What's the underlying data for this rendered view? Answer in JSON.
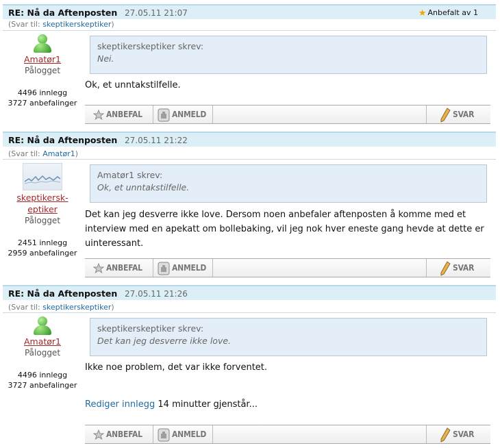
{
  "posts": [
    {
      "title": "RE: Nå da Aftenposten",
      "date": "27.05.11 21:07",
      "recommended": "Anbefalt av 1",
      "reply_prefix": "(Svar til:",
      "reply_to": "skeptikerskeptiker",
      "reply_suffix": ")",
      "author_line1": "Amatør1",
      "author_line2": "",
      "status": "Pålogget",
      "posts_count": "4496 innlegg",
      "recommendations": "3727 anbefalinger",
      "quote_author": "skeptikerskeptiker skrev:",
      "quote_text": "Nei.",
      "body": "Ok, et unntakstilfelle.",
      "avatar": "person-icon"
    },
    {
      "title": "RE: Nå da Aftenposten",
      "date": "27.05.11 21:22",
      "reply_prefix": "(Svar til:",
      "reply_to": "Amatør1",
      "reply_suffix": ")",
      "author_line1": "skeptikersk-",
      "author_line2": "eptiker",
      "status": "Pålogget",
      "posts_count": "2451 innlegg",
      "recommendations": "2959 anbefalinger",
      "quote_author": "Amatør1 skrev:",
      "quote_text": "Ok, et unntakstilfelle.",
      "body": "Det kan jeg desverre ikke love. Dersom noen anbefaler aftenposten å komme med et interview med en apekatt om bollebaking, vil jeg nok hver eneste gang hevde at dette er uinteressant.",
      "avatar": "chart-thumbnail"
    },
    {
      "title": "RE: Nå da Aftenposten",
      "date": "27.05.11 21:26",
      "reply_prefix": "(Svar til:",
      "reply_to": "skeptikerskeptiker",
      "reply_suffix": ")",
      "author_line1": "Amatør1",
      "author_line2": "",
      "status": "Pålogget",
      "posts_count": "4496 innlegg",
      "recommendations": "3727 anbefalinger",
      "quote_author": "skeptikerskeptiker skrev:",
      "quote_text": "Det kan jeg desverre ikke love.",
      "body": "Ikke noe problem, det var ikke forventet.",
      "edit_link": "Rediger innlegg",
      "edit_remaining": "14 minutter gjenstår...",
      "avatar": "person-icon"
    }
  ],
  "actions": {
    "recommend": "ANBEFAL",
    "report": "ANMELD",
    "reply": "SVAR"
  },
  "colors": {
    "header_bg": "#dceef6",
    "quote_bg": "#e3eef8",
    "username": "#a52828",
    "link": "#1f6aa3",
    "star": "#f0a800"
  }
}
